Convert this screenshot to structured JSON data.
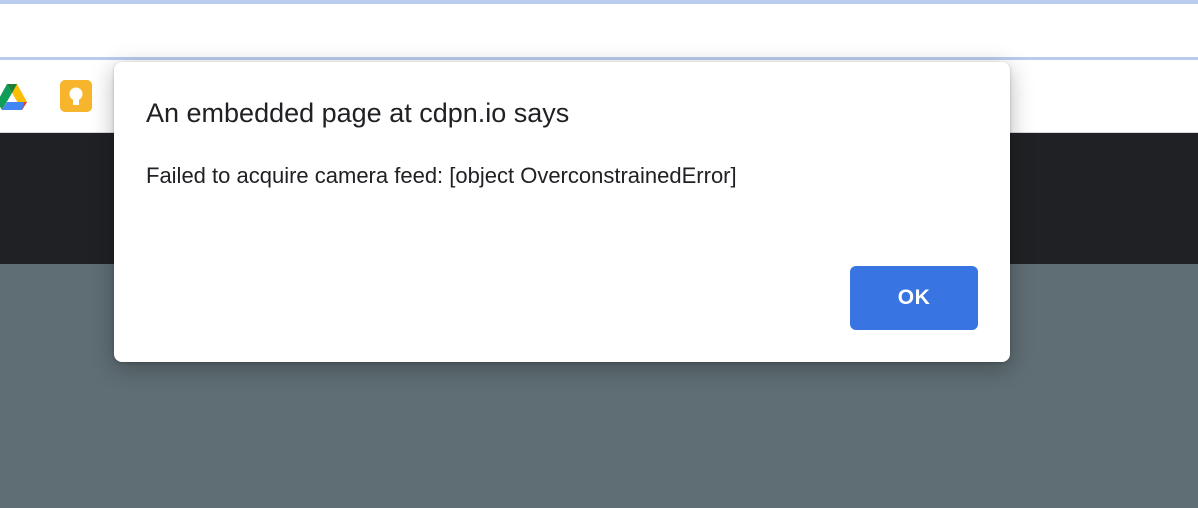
{
  "browser": {
    "bookmarks": [
      {
        "icon": "google-drive-icon"
      },
      {
        "icon": "google-keep-icon"
      }
    ]
  },
  "dialog": {
    "title": "An embedded page at cdpn.io says",
    "message": "Failed to acquire camera feed: [object OverconstrainedError]",
    "ok_label": "OK"
  },
  "colors": {
    "ok_button": "#3874e2",
    "page_dark": "#1f2125",
    "page_body": "#5f6e74",
    "toolbar_accent": "#b9cbee"
  }
}
